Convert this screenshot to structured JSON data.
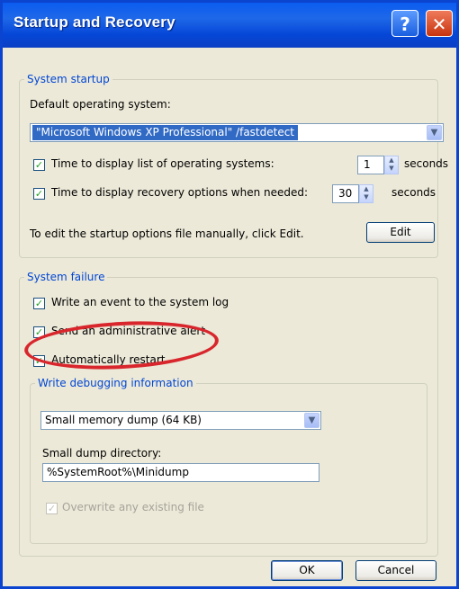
{
  "window": {
    "title": "Startup and Recovery",
    "help_glyph": "?",
    "close_glyph": "✕"
  },
  "system_startup": {
    "legend": "System startup",
    "default_os_label": "Default operating system:",
    "default_os_value": "\"Microsoft Windows XP Professional\" /fastdetect",
    "time_list": {
      "checked": true,
      "label": "Time to display list of operating systems:",
      "value": "1",
      "unit": "seconds"
    },
    "time_recovery": {
      "checked": true,
      "label": "Time to display recovery options when needed:",
      "value": "30",
      "unit": "seconds"
    },
    "edit_hint": "To edit the startup options file manually, click Edit.",
    "edit_button": "Edit"
  },
  "system_failure": {
    "legend": "System failure",
    "write_event": {
      "checked": true,
      "label": "Write an event to the system log"
    },
    "send_alert": {
      "checked": true,
      "label": "Send an administrative alert"
    },
    "auto_restart": {
      "checked": true,
      "label": "Automatically restart"
    },
    "debug": {
      "legend": "Write debugging information",
      "dump_type": "Small memory dump (64 KB)",
      "dir_label": "Small dump directory:",
      "dir_value": "%SystemRoot%\\Minidump",
      "overwrite": {
        "checked": true,
        "label": "Overwrite any existing file",
        "enabled": false
      }
    }
  },
  "buttons": {
    "ok": "OK",
    "cancel": "Cancel"
  },
  "icons": {
    "check": "✓",
    "dropdown_arrow": "▼",
    "spin_up": "▲",
    "spin_down": "▼"
  },
  "annotation_color": "#d8262c"
}
